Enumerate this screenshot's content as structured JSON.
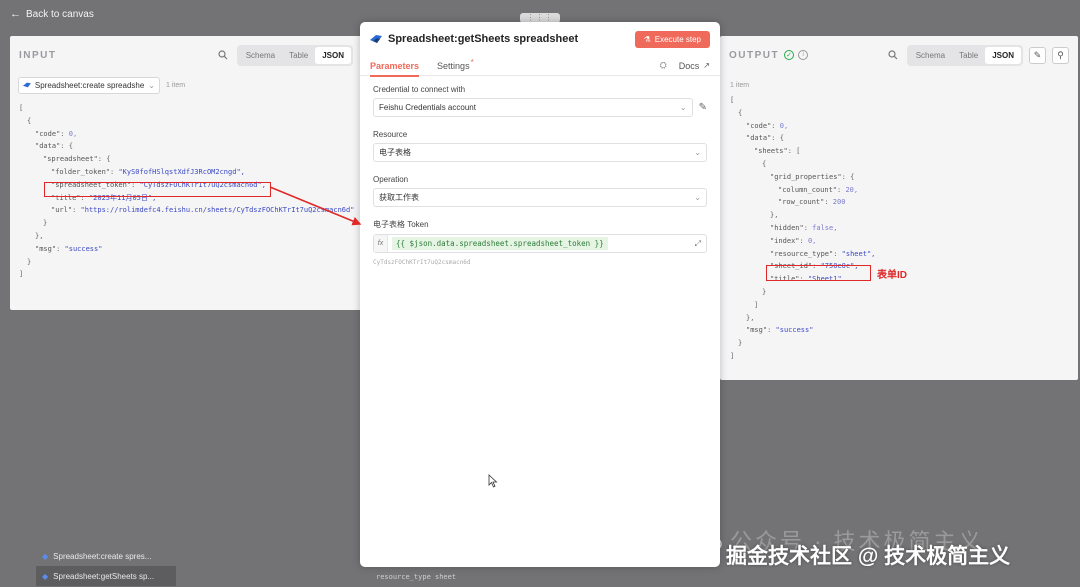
{
  "nav": {
    "back_label": "Back to canvas"
  },
  "input_panel": {
    "title": "INPUT",
    "view_tabs": [
      "Schema",
      "Table",
      "JSON"
    ],
    "selected_view": "JSON",
    "node_selector": "Spreadsheet:create spreadshe",
    "item_count": "1 item",
    "json_lines": [
      {
        "indent": 0,
        "text": "["
      },
      {
        "indent": 1,
        "text": "{"
      },
      {
        "indent": 2,
        "key": "\"code\"",
        "num": "0,"
      },
      {
        "indent": 2,
        "key": "\"data\"",
        "after": "{"
      },
      {
        "indent": 3,
        "key": "\"spreadsheet\"",
        "after": "{"
      },
      {
        "indent": 4,
        "key": "\"folder_token\"",
        "str": "\"KyS0fofHSlqstXdfJ3RcOM2cngd\","
      },
      {
        "indent": 4,
        "key": "\"spreadsheet_token\"",
        "str": "\"CyTdszFOChKTrIt7uQ2csmacn6d\","
      },
      {
        "indent": 4,
        "key": "\"title\"",
        "str": "\"2025年11月05日\","
      },
      {
        "indent": 4,
        "key": "\"url\"",
        "str": "\"https://rolimdefc4.feishu.cn/sheets/CyTdszFOChKTrIt7uQ2csmacn6d\""
      },
      {
        "indent": 3,
        "text": "}"
      },
      {
        "indent": 2,
        "text": "},"
      },
      {
        "indent": 2,
        "key": "\"msg\"",
        "str": "\"success\""
      },
      {
        "indent": 1,
        "text": "}"
      },
      {
        "indent": 0,
        "text": "]"
      }
    ]
  },
  "center_panel": {
    "title": "Spreadsheet:getSheets spreadsheet",
    "execute_label": "Execute step",
    "tabs": {
      "parameters": "Parameters",
      "settings": "Settings"
    },
    "docs_label": "Docs",
    "credential_label": "Credential to connect with",
    "credential_value": "Feishu Credentials account",
    "resource_label": "Resource",
    "resource_value": "电子表格",
    "operation_label": "Operation",
    "operation_value": "获取工作表",
    "token_label": "电子表格 Token",
    "token_expression": "{{ $json.data.spreadsheet.spreadsheet_token }}",
    "token_resolved": "CyTdszFOChKTrIt7uQ2csmacn6d"
  },
  "output_panel": {
    "title": "OUTPUT",
    "view_tabs": [
      "Schema",
      "Table",
      "JSON"
    ],
    "selected_view": "JSON",
    "item_count": "1 item",
    "json_lines": [
      {
        "indent": 0,
        "text": "["
      },
      {
        "indent": 1,
        "text": "{"
      },
      {
        "indent": 2,
        "key": "\"code\"",
        "num": "0,"
      },
      {
        "indent": 2,
        "key": "\"data\"",
        "after": "{"
      },
      {
        "indent": 3,
        "key": "\"sheets\"",
        "after": "["
      },
      {
        "indent": 4,
        "text": "{"
      },
      {
        "indent": 5,
        "key": "\"grid_properties\"",
        "after": "{"
      },
      {
        "indent": 6,
        "key": "\"column_count\"",
        "num": "20,"
      },
      {
        "indent": 6,
        "key": "\"row_count\"",
        "num": "200"
      },
      {
        "indent": 5,
        "text": "},"
      },
      {
        "indent": 5,
        "key": "\"hidden\"",
        "num": "false,"
      },
      {
        "indent": 5,
        "key": "\"index\"",
        "num": "0,"
      },
      {
        "indent": 5,
        "key": "\"resource_type\"",
        "str": "\"sheet\","
      },
      {
        "indent": 5,
        "key": "\"sheet_id\"",
        "str": "\"750e0c\","
      },
      {
        "indent": 5,
        "key": "\"title\"",
        "str": "\"Sheet1\""
      },
      {
        "indent": 4,
        "text": "}"
      },
      {
        "indent": 3,
        "text": "]"
      },
      {
        "indent": 2,
        "text": "},"
      },
      {
        "indent": 2,
        "key": "\"msg\"",
        "str": "\"success\""
      },
      {
        "indent": 1,
        "text": "}"
      },
      {
        "indent": 0,
        "text": "]"
      }
    ]
  },
  "annotation": {
    "label": "表单ID",
    "color": "#e02828"
  },
  "canvas_nodes": [
    "Spreadsheet:create spres...",
    "Spreadsheet:getSheets sp..."
  ],
  "canvas_bottom_text": "resource_type  sheet",
  "watermark": {
    "line1": "公众号 · 技术极简主义",
    "line2": "掘金技术社区 @ 技术极简主义"
  },
  "colors": {
    "accent": "#ef6a5a",
    "string": "#3b49c2",
    "success": "#2aa84a"
  }
}
